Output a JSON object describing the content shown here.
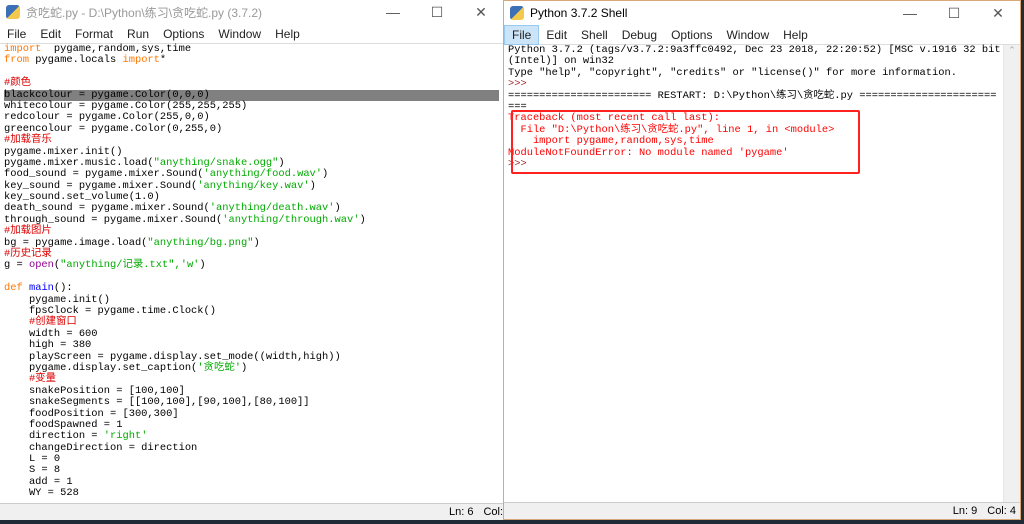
{
  "editor": {
    "title": "贪吃蛇.py - D:\\Python\\练习\\贪吃蛇.py (3.7.2)",
    "menu": [
      "File",
      "Edit",
      "Format",
      "Run",
      "Options",
      "Window",
      "Help"
    ],
    "status": {
      "ln": "Ln: 6",
      "col": "Col:"
    },
    "highlight_line": 4,
    "lines": [
      [
        [
          "kw",
          "import"
        ],
        [
          "",
          "  pygame,random,sys,time"
        ]
      ],
      [
        [
          "kw",
          "from"
        ],
        [
          "",
          " pygame.locals "
        ],
        [
          "kw",
          "import"
        ],
        [
          "",
          "*"
        ]
      ],
      [],
      [
        [
          "cm",
          "#颜色"
        ]
      ],
      [
        [
          "",
          "blackcolour = pygame.Color(0,0,0)"
        ]
      ],
      [
        [
          "",
          "whitecolour = pygame.Color(255,255,255)"
        ]
      ],
      [
        [
          "",
          "redcolour = pygame.Color(255,0,0)"
        ]
      ],
      [
        [
          "",
          "greencolour = pygame.Color(0,255,0)"
        ]
      ],
      [
        [
          "cm",
          "#加载音乐"
        ]
      ],
      [
        [
          "",
          "pygame.mixer.init()"
        ]
      ],
      [
        [
          "",
          "pygame.mixer.music.load("
        ],
        [
          "st",
          "\"anything/snake.ogg\""
        ],
        [
          "",
          ")"
        ]
      ],
      [
        [
          "",
          "food_sound = pygame.mixer.Sound("
        ],
        [
          "st",
          "'anything/food.wav'"
        ],
        [
          "",
          ")"
        ]
      ],
      [
        [
          "",
          "key_sound = pygame.mixer.Sound("
        ],
        [
          "st",
          "'anything/key.wav'"
        ],
        [
          "",
          ")"
        ]
      ],
      [
        [
          "",
          "key_sound.set_volume(1.0)"
        ]
      ],
      [
        [
          "",
          "death_sound = pygame.mixer.Sound("
        ],
        [
          "st",
          "'anything/death.wav'"
        ],
        [
          "",
          ")"
        ]
      ],
      [
        [
          "",
          "through_sound = pygame.mixer.Sound("
        ],
        [
          "st",
          "'anything/through.wav'"
        ],
        [
          "",
          ")"
        ]
      ],
      [
        [
          "cm",
          "#加载图片"
        ]
      ],
      [
        [
          "",
          "bg = pygame.image.load("
        ],
        [
          "st",
          "\"anything/bg.png\""
        ],
        [
          "",
          ")"
        ]
      ],
      [
        [
          "cm",
          "#历史记录"
        ]
      ],
      [
        [
          "",
          "g = "
        ],
        [
          "bi",
          "open"
        ],
        [
          "",
          "("
        ],
        [
          "st",
          "\"anything/记录.txt\",'w'"
        ],
        [
          "",
          ")"
        ]
      ],
      [],
      [
        [
          "kw",
          "def"
        ],
        [
          "",
          " "
        ],
        [
          "df",
          "main"
        ],
        [
          "",
          "():"
        ]
      ],
      [
        [
          "",
          "    pygame.init()"
        ]
      ],
      [
        [
          "",
          "    fpsClock = pygame.time.Clock()"
        ]
      ],
      [
        [
          "cm",
          "    #创建窗口"
        ]
      ],
      [
        [
          "",
          "    width = 600"
        ]
      ],
      [
        [
          "",
          "    high = 380"
        ]
      ],
      [
        [
          "",
          "    playScreen = pygame.display.set_mode((width,high))"
        ]
      ],
      [
        [
          "",
          "    pygame.display.set_caption("
        ],
        [
          "st",
          "'贪吃蛇'"
        ],
        [
          "",
          ")"
        ]
      ],
      [
        [
          "cm",
          "    #变量"
        ]
      ],
      [
        [
          "",
          "    snakePosition = [100,100]"
        ]
      ],
      [
        [
          "",
          "    snakeSegments = [[100,100],[90,100],[80,100]]"
        ]
      ],
      [
        [
          "",
          "    foodPosition = [300,300]"
        ]
      ],
      [
        [
          "",
          "    foodSpawned = 1"
        ]
      ],
      [
        [
          "",
          "    direction = "
        ],
        [
          "st",
          "'right'"
        ]
      ],
      [
        [
          "",
          "    changeDirection = direction"
        ]
      ],
      [
        [
          "",
          "    L = 0"
        ]
      ],
      [
        [
          "",
          "    S = 8"
        ]
      ],
      [
        [
          "",
          "    add = 1"
        ]
      ],
      [
        [
          "",
          "    WY = 528"
        ]
      ]
    ]
  },
  "shell": {
    "title": "Python 3.7.2 Shell",
    "menu": [
      "File",
      "Edit",
      "Shell",
      "Debug",
      "Options",
      "Window",
      "Help"
    ],
    "active_menu": "File",
    "status": {
      "ln": "Ln: 9",
      "col": "Col: 4"
    },
    "lines": [
      [
        [
          "",
          "Python 3.7.2 (tags/v3.7.2:9a3ffc0492, Dec 23 2018, 22:20:52) [MSC v.1916 32 bit"
        ]
      ],
      [
        [
          "",
          "(Intel)] on win32"
        ]
      ],
      [
        [
          "",
          "Type \"help\", \"copyright\", \"credits\" or \"license()\" for more information."
        ]
      ],
      [
        [
          "pr",
          ">>> "
        ]
      ],
      [
        [
          "",
          "======================= RESTART: D:\\Python\\练习\\贪吃蛇.py ======================"
        ]
      ],
      [
        [
          "",
          "==="
        ]
      ],
      [
        [
          "er",
          "Traceback (most recent call last):"
        ]
      ],
      [
        [
          "er",
          "  File \"D:\\Python\\练习\\贪吃蛇.py\", line 1, in <module>"
        ]
      ],
      [
        [
          "er",
          "    import pygame,random,sys,time"
        ]
      ],
      [
        [
          "er",
          "ModuleNotFoundError: No module named 'pygame'"
        ]
      ],
      [
        [
          "pr",
          ">>> "
        ]
      ]
    ]
  },
  "colors": {
    "keyword": "#ff7700",
    "string": "#00aa00",
    "comment": "#dd0000",
    "error": "#ff0000",
    "annotation_box": "#ff2020"
  }
}
